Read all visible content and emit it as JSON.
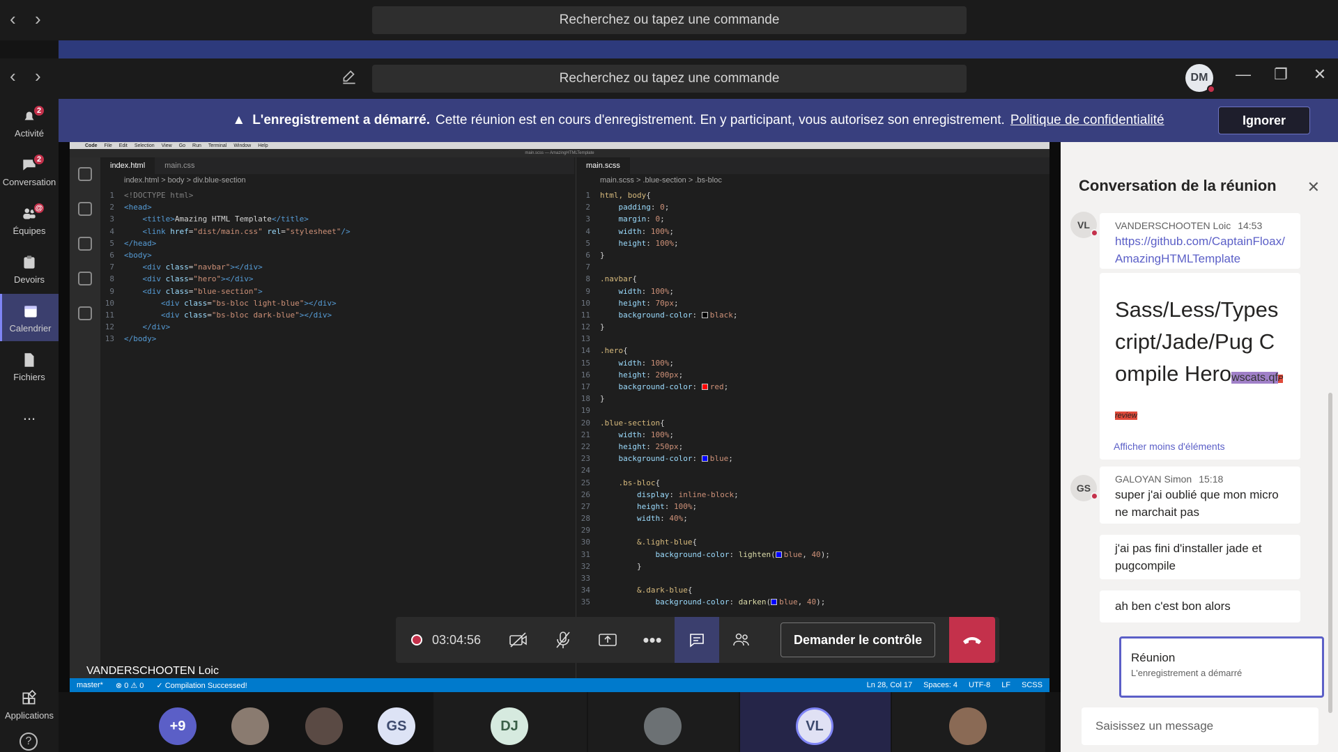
{
  "app": {
    "search_placeholder": "Recherchez ou tapez une commande",
    "user_initials": "DM",
    "colors": {
      "accent": "#5b5fc7",
      "banner": "#383f7e",
      "alert": "#c4314b"
    }
  },
  "rail": {
    "activity_badge": "2",
    "items": [
      {
        "label": "Activité",
        "icon": "bell-icon",
        "badge": "2"
      },
      {
        "label": "Conversation",
        "icon": "chat-icon",
        "badge": "2"
      },
      {
        "label": "Équipes",
        "icon": "teams-icon",
        "badge": "@"
      },
      {
        "label": "Devoirs",
        "icon": "assignments-icon",
        "badge": ""
      },
      {
        "label": "Calendrier",
        "icon": "calendar-icon",
        "badge": ""
      },
      {
        "label": "Fichiers",
        "icon": "files-icon",
        "badge": ""
      },
      {
        "label": "...",
        "icon": "more-icon",
        "badge": ""
      }
    ],
    "apps_label": "Applications"
  },
  "banner": {
    "bold": "L'enregistrement a démarré.",
    "text": "Cette réunion est en cours d'enregistrement. En y participant, vous autorisez son enregistrement.",
    "link": "Politique de confidentialité",
    "ignore": "Ignorer"
  },
  "vscode": {
    "menu": [
      "Code",
      "File",
      "Edit",
      "Selection",
      "View",
      "Go",
      "Run",
      "Terminal",
      "Window",
      "Help"
    ],
    "title": "main.scss — AmazingHTMLTemplate",
    "left_tabs": [
      "index.html",
      "main.css"
    ],
    "left_crumbs": "index.html > body > div.blue-section",
    "right_tab": "main.scss",
    "right_crumbs": "main.scss > .blue-section > .bs-bloc",
    "status": {
      "branch": "master*",
      "errors": "0",
      "warnings": "0",
      "compile": "✓ Compilation Successed!",
      "pos": "Ln 28, Col 17",
      "spaces": "Spaces: 4",
      "enc": "UTF-8",
      "eol": "LF",
      "lang": "SCSS"
    }
  },
  "presenter": "VANDERSCHOOTEN Loic",
  "call": {
    "timer": "03:04:56",
    "request_control": "Demander le contrôle"
  },
  "gallery": {
    "overflow": "+9",
    "people": [
      "GS",
      "DJ",
      "VL"
    ]
  },
  "chat": {
    "title": "Conversation de la réunion",
    "messages": [
      {
        "initials": "VL",
        "author": "VANDERSCHOOTEN Loic",
        "time": "14:53",
        "text": "https://github.com/CaptainFloax/AmazingHTMLTemplate"
      },
      {
        "preview_title": "Sass/Less/Typescript/Jade/Pug Compile Hero",
        "preview_host": "wscats.qf",
        "preview_tag": "Preview",
        "toggle": "Afficher moins d'éléments"
      },
      {
        "initials": "GS",
        "author": "GALOYAN Simon",
        "time": "15:18",
        "text": "super j'ai oublié que mon micro ne marchait pas"
      },
      {
        "text": "j'ai pas fini d'installer jade et pugcompile"
      },
      {
        "text": "ah ben c'est bon alors"
      }
    ],
    "card_title": "Réunion",
    "card_sub": "L'enregistrement a démarré",
    "compose_placeholder": "Saisissez un message"
  }
}
